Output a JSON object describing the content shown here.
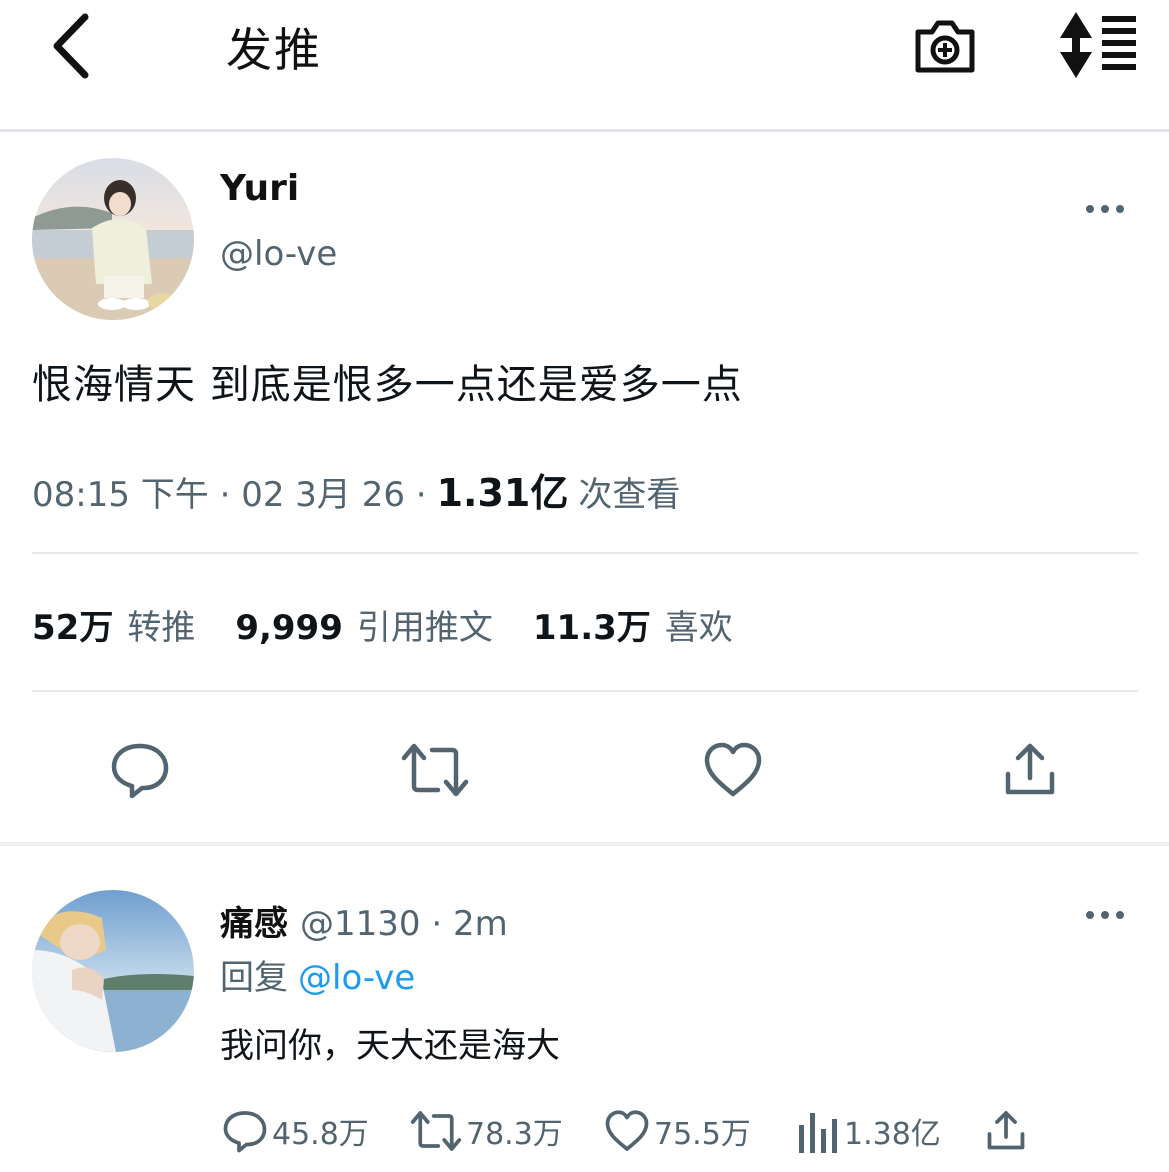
{
  "header": {
    "title": "发推",
    "icons": {
      "back": "back-chevron-icon",
      "camera": "camera-plus-icon",
      "sort": "sort-list-icon"
    }
  },
  "tweet": {
    "name": "Yuri",
    "handle": "@lo-ve",
    "text": "恨海情天 到底是恨多一点还是爱多一点",
    "time": "08:15 下午 · 02 3月 26 ·",
    "views_value": "1.31亿",
    "views_label": "次查看",
    "stats": {
      "retweets_value": "52万",
      "retweets_label": "转推",
      "quotes_value": "9,999",
      "quotes_label": "引用推文",
      "likes_value": "11.3万",
      "likes_label": "喜欢"
    },
    "actions": [
      "reply-icon",
      "retweet-icon",
      "like-icon",
      "share-icon"
    ]
  },
  "reply": {
    "name": "痛感",
    "handle_time": "@1130 · 2m",
    "reply_label": "回复",
    "reply_to": "@lo-ve",
    "text": "我问你，天大还是海大",
    "counts": {
      "replies": "45.8万",
      "retweets": "78.3万",
      "likes": "75.5万",
      "views": "1.38亿"
    }
  },
  "colors": {
    "accent": "#1d9bf0",
    "muted": "#536471",
    "text": "#0f1419"
  }
}
